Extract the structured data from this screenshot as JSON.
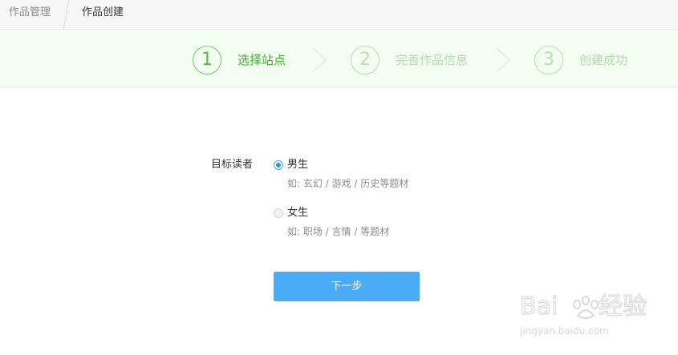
{
  "breadcrumb": {
    "parent": "作品管理",
    "current": "作品创建"
  },
  "steps": [
    {
      "number": "1",
      "label": "选择站点",
      "state": "active"
    },
    {
      "number": "2",
      "label": "完善作品信息",
      "state": "inactive"
    },
    {
      "number": "3",
      "label": "创建成功",
      "state": "inactive"
    }
  ],
  "form": {
    "audience_label": "目标读者",
    "options": [
      {
        "label": "男生",
        "hint": "如: 玄幻 / 游戏 / 历史等题材",
        "checked": true
      },
      {
        "label": "女生",
        "hint": "如: 职场 / 言情 / 等题材",
        "checked": false
      }
    ],
    "next_button": "下一步"
  },
  "watermark": {
    "logo_text": "Baidu经验",
    "url": "jingyan.baidu.com"
  },
  "colors": {
    "accent_green": "#52c041",
    "step_bg": "#f3fdf1",
    "button_blue": "#4aabf6",
    "radio_blue": "#2f8ff0"
  }
}
